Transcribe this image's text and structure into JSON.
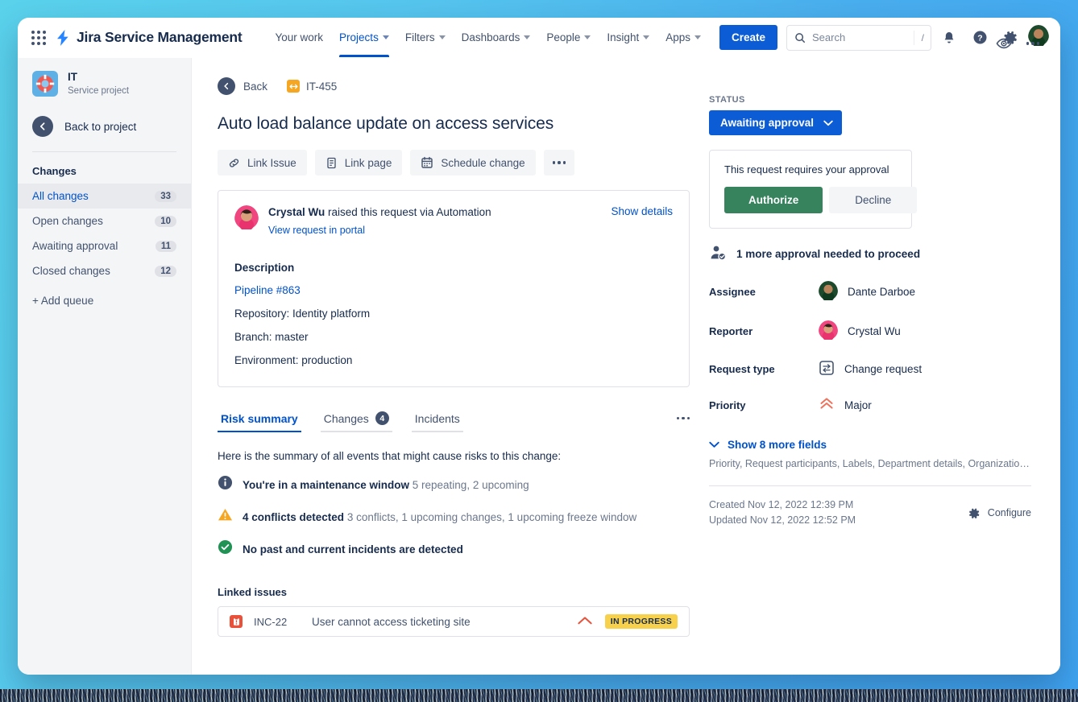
{
  "topnav": {
    "app_switcher_icon": "grid-apps-icon",
    "brand_icon": "jira-bolt-icon",
    "brand": "Jira Service Management",
    "items": [
      {
        "label": "Your work",
        "has_caret": false,
        "active": false
      },
      {
        "label": "Projects",
        "has_caret": true,
        "active": true
      },
      {
        "label": "Filters",
        "has_caret": true,
        "active": false
      },
      {
        "label": "Dashboards",
        "has_caret": true,
        "active": false
      },
      {
        "label": "People",
        "has_caret": true,
        "active": false
      },
      {
        "label": "Insight",
        "has_caret": true,
        "active": false
      },
      {
        "label": "Apps",
        "has_caret": true,
        "active": false
      }
    ],
    "create_label": "Create",
    "search": {
      "placeholder": "Search",
      "value": "",
      "shortcut": "/"
    },
    "icons": [
      "notifications-bell-icon",
      "help-icon",
      "settings-gear-icon",
      "profile-avatar"
    ]
  },
  "sidebar": {
    "project": {
      "name": "IT",
      "type": "Service project",
      "icon": "lifebuoy-icon"
    },
    "back_to_project": "Back to project",
    "section_title": "Changes",
    "queues": [
      {
        "label": "All changes",
        "count": "33",
        "active": true
      },
      {
        "label": "Open changes",
        "count": "10",
        "active": false
      },
      {
        "label": "Awaiting approval",
        "count": "11",
        "active": false
      },
      {
        "label": "Closed changes",
        "count": "12",
        "active": false
      }
    ],
    "add_queue": "+ Add queue"
  },
  "issue": {
    "back_label": "Back",
    "key": "IT-455",
    "title": "Auto load balance update on access services",
    "actions": [
      {
        "label": "Link Issue",
        "icon": "link-icon"
      },
      {
        "label": "Link page",
        "icon": "page-icon"
      },
      {
        "label": "Schedule change",
        "icon": "calendar-icon"
      }
    ],
    "more_actions_label": "More actions",
    "watch_icon": "eye-watch-icon",
    "header_more_icon": "more-actions-icon"
  },
  "request_card": {
    "reporter": "Crystal Wu",
    "raised_text": " raised this request via Automation",
    "portal_link": "View request in portal",
    "show_details": "Show details",
    "description_heading": "Description",
    "description_lines": [
      {
        "text": "Pipeline #863",
        "is_link": true
      },
      {
        "text": "Repository: Identity platform",
        "is_link": false
      },
      {
        "text": "Branch: master",
        "is_link": false
      },
      {
        "text": "Environment: production",
        "is_link": false
      }
    ]
  },
  "tabs": [
    {
      "label": "Risk summary",
      "count": null,
      "active": true
    },
    {
      "label": "Changes",
      "count": "4",
      "active": false
    },
    {
      "label": "Incidents",
      "count": null,
      "active": false
    }
  ],
  "risk_summary": {
    "intro": "Here is the summary of all events that might cause risks to this change:",
    "items": [
      {
        "icon": "info-icon",
        "bold": "You're in a maintenance window",
        "muted": "5 repeating, 2 upcoming"
      },
      {
        "icon": "warning-icon",
        "bold": "4 conflicts detected",
        "muted": "3 conflicts, 1 upcoming changes, 1 upcoming freeze window"
      },
      {
        "icon": "success-check-icon",
        "bold": "No past and current incidents are detected",
        "muted": ""
      }
    ]
  },
  "linked_issues": {
    "heading": "Linked issues",
    "rows": [
      {
        "icon": "incident-icon",
        "key": "INC-22",
        "summary": "User cannot access ticketing site",
        "priority_icon": "priority-high-icon",
        "status": "IN PROGRESS"
      }
    ]
  },
  "details": {
    "status_label": "STATUS",
    "status_value": "Awaiting approval",
    "approval": {
      "prompt": "This request requires your approval",
      "authorize_label": "Authorize",
      "decline_label": "Decline",
      "note": "1 more approval needed to proceed",
      "note_icon": "approver-person-icon"
    },
    "fields": [
      {
        "label": "Assignee",
        "value": "Dante Darboe",
        "icon": "assignee-avatar"
      },
      {
        "label": "Reporter",
        "value": "Crystal Wu",
        "icon": "reporter-avatar"
      },
      {
        "label": "Request type",
        "value": "Change request",
        "icon": "change-request-icon"
      },
      {
        "label": "Priority",
        "value": "Major",
        "icon": "priority-major-icon"
      }
    ],
    "show_more_label": "Show 8 more fields",
    "more_fields": "Priority, Request participants, Labels, Department details, Organizations, T...",
    "created": "Created Nov 12, 2022 12:39 PM",
    "updated": "Updated Nov 12, 2022 12:52 PM",
    "configure_label": "Configure",
    "configure_icon": "settings-gear-icon"
  },
  "colors": {
    "brand_blue": "#0052CC",
    "create_blue": "#0B5CD5",
    "authorize_green": "#36835E",
    "status_yellow": "#F7D14C",
    "warning_amber": "#F5A623",
    "incident_red": "#E9513A",
    "success_green": "#1F9254",
    "text_dark": "#172B4D",
    "text_muted": "#6B778C"
  }
}
